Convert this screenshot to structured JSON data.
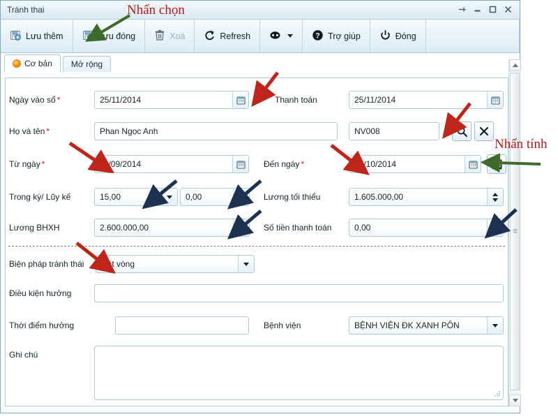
{
  "window": {
    "title": "Tránh thai",
    "controls": [
      {
        "name": "pin",
        "label": "Pin"
      },
      {
        "name": "minimize",
        "label": "Minimize"
      },
      {
        "name": "maximize",
        "label": "Maximize"
      },
      {
        "name": "close",
        "label": "Close"
      }
    ]
  },
  "toolbar": {
    "buttons": [
      {
        "key": "save_add",
        "label": "Lưu thêm",
        "icon": "save-add-icon",
        "disabled": false,
        "dropdown": false
      },
      {
        "key": "save_close",
        "label": "Lưu đóng",
        "icon": "save-close-icon",
        "disabled": false,
        "dropdown": false
      },
      {
        "key": "delete",
        "label": "Xoá",
        "icon": "trash-icon",
        "disabled": true,
        "dropdown": false
      },
      {
        "key": "refresh",
        "label": "Refresh",
        "icon": "refresh-icon",
        "disabled": false,
        "dropdown": false
      },
      {
        "key": "more",
        "label": "",
        "icon": "more-icon",
        "disabled": false,
        "dropdown": true
      },
      {
        "key": "help",
        "label": "Trợ giúp",
        "icon": "help-icon",
        "disabled": false,
        "dropdown": false
      },
      {
        "key": "close",
        "label": "Đóng",
        "icon": "power-icon",
        "disabled": false,
        "dropdown": false
      }
    ]
  },
  "tabs": [
    {
      "key": "basic",
      "label": "Cơ bản",
      "active": true
    },
    {
      "key": "extended",
      "label": "Mở rộng",
      "active": false
    }
  ],
  "form": {
    "entry_date": {
      "label": "Ngày vào sổ",
      "required": true,
      "value": "25/11/2014"
    },
    "payment_date": {
      "label": "Thanh toán",
      "required": false,
      "value": "25/11/2014"
    },
    "full_name": {
      "label": "Họ và tên",
      "required": true,
      "value": "Phan Ngọc Anh"
    },
    "employee_code": {
      "label": "",
      "required": false,
      "value": "NV008"
    },
    "from_date": {
      "label": "Từ ngày",
      "required": true,
      "value": "11/09/2014"
    },
    "to_date": {
      "label": "Đến ngày",
      "required": true,
      "value": "06/10/2014"
    },
    "in_period": {
      "label": "Trong kỳ/ Lũy kế",
      "required": false,
      "value": "15,00"
    },
    "accumulated": {
      "label": "",
      "required": false,
      "value": "0,00"
    },
    "min_salary": {
      "label": "Lương tối thiểu",
      "required": false,
      "value": "1.605.000,00"
    },
    "bhxh_salary": {
      "label": "Lương BHXH",
      "required": false,
      "value": "2.600.000,00"
    },
    "payment_amount": {
      "label": "Số tiền thanh toán",
      "required": false,
      "value": "0,00"
    },
    "contraceptive": {
      "label": "Biện pháp tránh thái",
      "required": false,
      "value": "Đặt vòng"
    },
    "condition": {
      "label": "Điều kiện hưởng",
      "required": false,
      "value": ""
    },
    "time_point": {
      "label": "Thời điểm hưởng",
      "required": false,
      "value": ""
    },
    "hospital": {
      "label": "Bệnh viện",
      "required": false,
      "value": "BỆNH VIỆN ĐK XANH PÔN"
    },
    "note": {
      "label": "Ghi chú",
      "required": false,
      "value": ""
    }
  },
  "field_buttons": {
    "search": {
      "name": "search-button",
      "icon": "magnifier-icon"
    },
    "clear": {
      "name": "clear-button",
      "icon": "x-icon"
    },
    "calculate": {
      "name": "calculate-button",
      "icon": "calculator-icon"
    },
    "calendar": {
      "name": "calendar-button",
      "icon": "calendar-icon"
    }
  },
  "annotations": [
    {
      "key": "press_select",
      "text": "Nhấn chọn",
      "color": "#c21616",
      "arrow_color": "#3f6b2a"
    },
    {
      "key": "press_calc",
      "text": "Nhấn tính",
      "color": "#c21616",
      "arrow_color": "#3f6b2a"
    }
  ],
  "colors": {
    "accent": "#a8cbdc",
    "titlebar": "#e4f0f6",
    "required_star": "#d21414",
    "annotation_red": "#c21616",
    "annotation_green": "#3f6b2a",
    "arrow_dark_red": "#c0251c",
    "arrow_navy": "#1c3250"
  },
  "scrollbar": {
    "orientation": "vertical",
    "position": "top"
  }
}
